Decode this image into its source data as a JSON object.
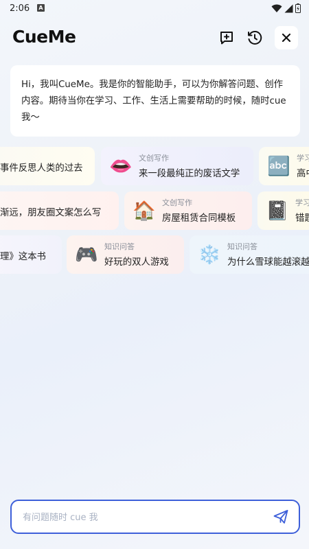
{
  "status_bar": {
    "time": "2:06",
    "notification_glyph": "A"
  },
  "header": {
    "title": "CueMe",
    "icons": [
      "new-chat-icon",
      "history-icon",
      "close-icon"
    ]
  },
  "greeting": {
    "text": "Hi，我叫CueMe。我是你的智能助手，可以为你解答问题、创作内容。期待当你在学习、工作、生活上需要帮助的时候，随时cue我～"
  },
  "suggestions": {
    "row1": [
      {
        "category": "",
        "text": "事件反思人类的过去",
        "emoji": ""
      },
      {
        "category": "文创写作",
        "text": "来一段最纯正的废话文学",
        "emoji": "👄"
      },
      {
        "category": "学习",
        "text": "高中",
        "emoji": "🔤"
      }
    ],
    "row2": [
      {
        "category": "",
        "text": "渐远，朋友圈文案怎么写",
        "emoji": ""
      },
      {
        "category": "文创写作",
        "text": "房屋租赁合同模板",
        "emoji": "🏠"
      },
      {
        "category": "学习",
        "text": "错题",
        "emoji": "📓"
      }
    ],
    "row3": [
      {
        "category": "",
        "text": "理》这本书",
        "emoji": ""
      },
      {
        "category": "知识问答",
        "text": "好玩的双人游戏",
        "emoji": "🎮"
      },
      {
        "category": "知识问答",
        "text": "为什么雪球能越滚越",
        "emoji": "❄️"
      }
    ]
  },
  "input": {
    "placeholder": "有问题随时 cue 我"
  },
  "colors": {
    "accent": "#3d5fd9",
    "card": "#ffffff",
    "muted": "#8a8f99"
  }
}
